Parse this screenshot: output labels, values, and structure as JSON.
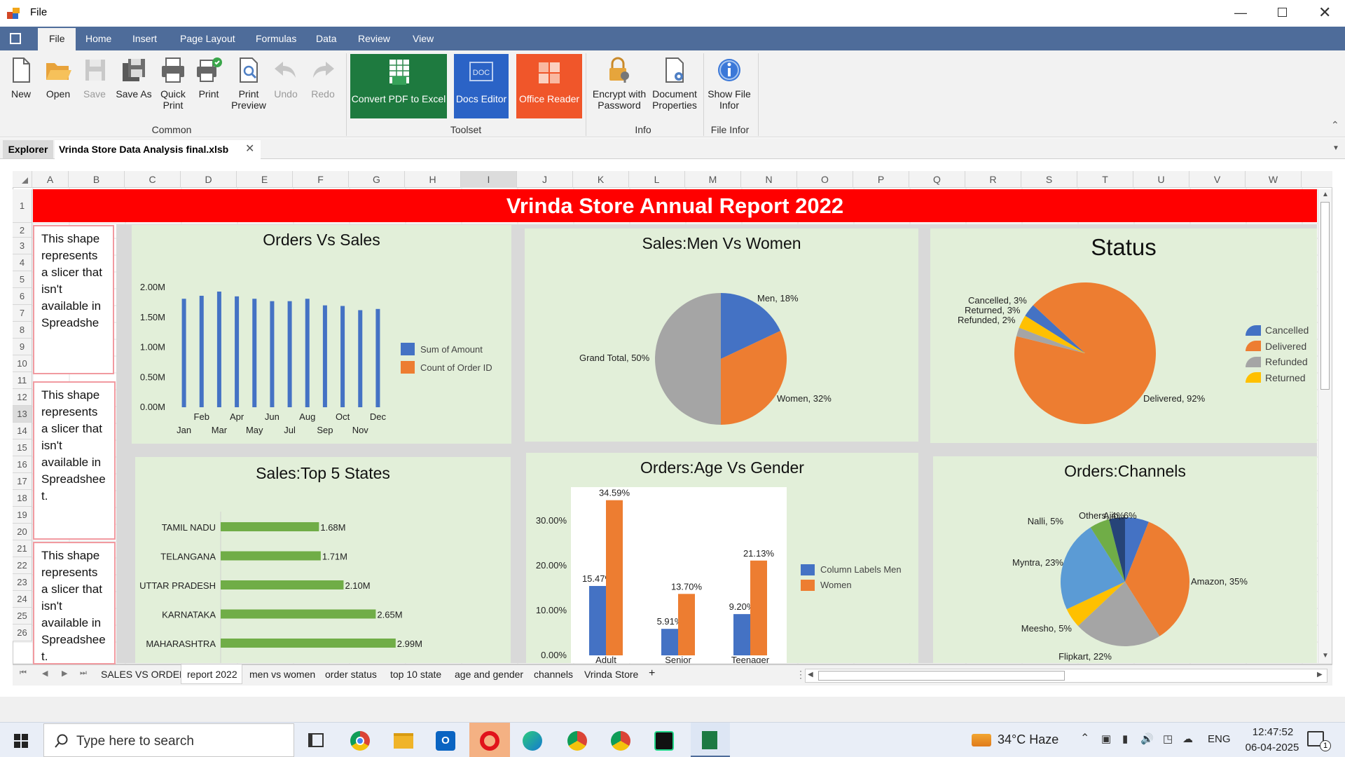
{
  "window": {
    "title": "File"
  },
  "menu": {
    "tabs": [
      "File",
      "Home",
      "Insert",
      "Page Layout",
      "Formulas",
      "Data",
      "Review",
      "View"
    ]
  },
  "ribbon": {
    "buttons": {
      "new": "New",
      "open": "Open",
      "save": "Save",
      "save_as": "Save As",
      "quick_print_1": "Quick",
      "quick_print_2": "Print",
      "print": "Print",
      "print_preview_1": "Print",
      "print_preview_2": "Preview",
      "undo": "Undo",
      "redo": "Redo",
      "convert_pdf": "Convert PDF to Excel",
      "docs_editor": "Docs Editor",
      "office_reader": "Office Reader",
      "encrypt_1": "Encrypt with",
      "encrypt_2": "Password",
      "doc_props_1": "Document",
      "doc_props_2": "Properties",
      "show_file_1": "Show File",
      "show_file_2": "Infor"
    },
    "groups": {
      "common": "Common",
      "toolset": "Toolset",
      "info": "Info",
      "file_infor": "File Infor"
    },
    "colors": {
      "convert": "#1e7a3f",
      "docs": "#2b63c6",
      "reader": "#f0562a"
    }
  },
  "doc_tabs": {
    "explorer": "Explorer",
    "active": "Vrinda Store Data Analysis final.xlsb"
  },
  "columns": [
    "A",
    "B",
    "C",
    "D",
    "E",
    "F",
    "G",
    "H",
    "I",
    "J",
    "K",
    "L",
    "M",
    "N",
    "O",
    "P",
    "Q",
    "R",
    "S",
    "T",
    "U",
    "V",
    "W"
  ],
  "rows": [
    "1",
    "2",
    "3",
    "4",
    "5",
    "6",
    "7",
    "8",
    "9",
    "10",
    "11",
    "12",
    "13",
    "14",
    "15",
    "16",
    "17",
    "18",
    "19",
    "20",
    "21",
    "22",
    "23",
    "24",
    "25",
    "26"
  ],
  "report": {
    "title": "Vrinda Store Annual Report 2022",
    "title_bg": "#ff0000"
  },
  "slicers": [
    "This shape represents a slicer that isn't available in Spreadshe",
    "This shape represents a slicer that isn't available in Spreadshee t.",
    "This shape represents a slicer that isn't available in Spreadshee t."
  ],
  "charts": {
    "orders_sales": {
      "title": "Orders Vs Sales",
      "legend": [
        "Sum of Amount",
        "Count of Order ID"
      ]
    },
    "men_women": {
      "title": "Sales:Men Vs Women"
    },
    "status": {
      "title": "Status",
      "legend": [
        "Cancelled",
        "Delivered",
        "Refunded",
        "Returned"
      ]
    },
    "top_states": {
      "title": "Sales:Top 5 States"
    },
    "age_gender": {
      "title": "Orders:Age Vs Gender",
      "legend": [
        "Column Labels Men",
        "Women"
      ]
    },
    "channels": {
      "title": "Orders:Channels"
    }
  },
  "chart_data": [
    {
      "type": "bar",
      "title": "Orders Vs Sales",
      "categories": [
        "Jan",
        "Feb",
        "Mar",
        "Apr",
        "May",
        "Jun",
        "Jul",
        "Aug",
        "Sep",
        "Oct",
        "Nov",
        "Dec"
      ],
      "series": [
        {
          "name": "Sum of Amount",
          "values": [
            1.81,
            1.86,
            1.93,
            1.85,
            1.81,
            1.77,
            1.77,
            1.81,
            1.7,
            1.69,
            1.62,
            1.64
          ]
        },
        {
          "name": "Count of Order ID",
          "values": [
            0,
            0,
            0,
            0,
            0,
            0,
            0,
            0,
            0,
            0,
            0,
            0
          ]
        }
      ],
      "ytick_labels": [
        "0.00M",
        "0.50M",
        "1.00M",
        "1.50M",
        "2.00M"
      ],
      "ylim": [
        0,
        2.0
      ],
      "unit": "M",
      "colors": [
        "#4472c4",
        "#ed7d31"
      ]
    },
    {
      "type": "pie",
      "title": "Sales:Men Vs Women",
      "labels": [
        "Men",
        "Women",
        "Grand Total"
      ],
      "values": [
        18,
        32,
        50
      ],
      "data_labels": [
        "Men, 18%",
        "Women, 32%",
        "Grand Total, 50%"
      ],
      "colors": [
        "#4472c4",
        "#ed7d31",
        "#a5a5a5"
      ]
    },
    {
      "type": "pie",
      "title": "Status",
      "labels": [
        "Cancelled",
        "Delivered",
        "Refunded",
        "Returned"
      ],
      "values": [
        3,
        92,
        2,
        3
      ],
      "data_labels": [
        "Cancelled, 3%",
        "Delivered, 92%",
        "Refunded, 2%",
        "Returned, 3%"
      ],
      "colors": [
        "#4472c4",
        "#ed7d31",
        "#a5a5a5",
        "#ffc000"
      ],
      "legend": "right"
    },
    {
      "type": "bar",
      "orientation": "horizontal",
      "title": "Sales:Top 5 States",
      "categories": [
        "TAMIL NADU",
        "TELANGANA",
        "UTTAR PRADESH",
        "KARNATAKA",
        "MAHARASHTRA"
      ],
      "values": [
        1.68,
        1.71,
        2.1,
        2.65,
        2.99
      ],
      "data_labels": [
        "1.68M",
        "1.71M",
        "2.10M",
        "2.65M",
        "2.99M"
      ],
      "color": "#70ad47"
    },
    {
      "type": "bar",
      "title": "Orders:Age Vs Gender",
      "categories": [
        "Adult",
        "Senior",
        "Teenager"
      ],
      "series": [
        {
          "name": "Column Labels Men",
          "values": [
            15.47,
            5.91,
            9.2
          ]
        },
        {
          "name": "Women",
          "values": [
            34.59,
            13.7,
            21.13
          ]
        }
      ],
      "data_labels": [
        [
          "15.47%",
          "5.91%",
          "9.20%"
        ],
        [
          "34.59%",
          "13.70%",
          "21.13%"
        ]
      ],
      "ytick_labels": [
        "0.00%",
        "10.00%",
        "20.00%",
        "30.00%"
      ],
      "ylim": [
        0,
        36
      ],
      "colors": [
        "#4472c4",
        "#ed7d31"
      ]
    },
    {
      "type": "pie",
      "title": "Orders:Channels",
      "labels": [
        "Ajio",
        "Amazon",
        "Flipkart",
        "Meesho",
        "Myntra",
        "Nalli",
        "Others"
      ],
      "values": [
        6,
        35,
        22,
        5,
        23,
        5,
        4
      ],
      "data_labels": [
        "Ajio, 6%",
        "Amazon, 35%",
        "Flipkart, 22%",
        "Meesho, 5%",
        "Myntra, 23%",
        "Nalli, 5%",
        "Others, 4%"
      ],
      "colors": [
        "#4472c4",
        "#ed7d31",
        "#a5a5a5",
        "#ffc000",
        "#5b9bd5",
        "#70ad47",
        "#264478"
      ]
    }
  ],
  "sheet_tabs": [
    "SALES VS ORDER",
    "report 2022",
    "men vs women",
    "order status",
    "top 10 state",
    "age and gender",
    "channels",
    "Vrinda Store"
  ],
  "sheet_add": "+",
  "taskbar": {
    "search_placeholder": "Type here to search",
    "weather": "34°C  Haze",
    "lang": "ENG",
    "time": "12:47:52",
    "date": "06-04-2025",
    "notif_count": "1"
  }
}
